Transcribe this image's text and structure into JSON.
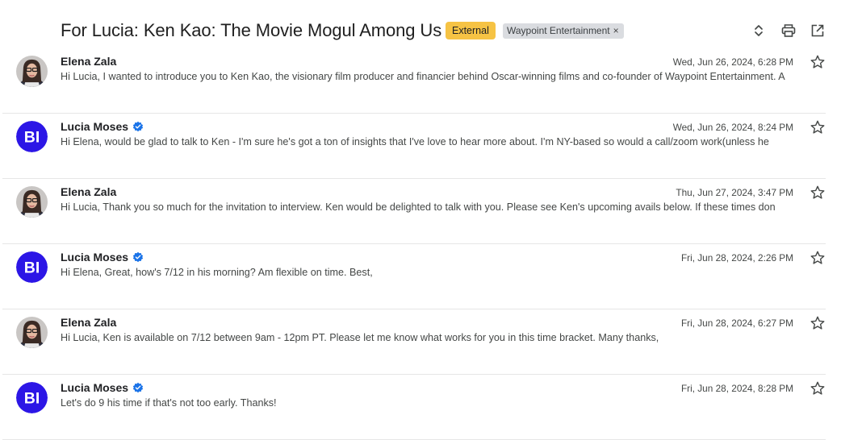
{
  "header": {
    "subject": "For Lucia: Ken Kao: The Movie Mogul Among Us",
    "labels": {
      "external": "External",
      "waypoint": "Waypoint Entertainment",
      "remove": "×"
    }
  },
  "messages": [
    {
      "sender": "Elena Zala",
      "verified": false,
      "avatar": "photo",
      "date": "Wed, Jun 26, 2024, 6:28 PM",
      "snippet": "Hi Lucia, I wanted to introduce you to Ken Kao, the visionary film producer and financier behind Oscar-winning films and co-founder of Waypoint Entertainment. A"
    },
    {
      "sender": "Lucia Moses",
      "verified": true,
      "avatar": "BI",
      "date": "Wed, Jun 26, 2024, 8:24 PM",
      "snippet": "Hi Elena, would be glad to talk to Ken - I'm sure he's got a ton of insights that I've love to hear more about. I'm NY-based so would a call/zoom work(unless he"
    },
    {
      "sender": "Elena Zala",
      "verified": false,
      "avatar": "photo",
      "date": "Thu, Jun 27, 2024, 3:47 PM",
      "snippet": "Hi Lucia, Thank you so much for the invitation to interview. Ken would be delighted to talk with you. Please see Ken's upcoming avails below. If these times don"
    },
    {
      "sender": "Lucia Moses",
      "verified": true,
      "avatar": "BI",
      "date": "Fri, Jun 28, 2024, 2:26 PM",
      "snippet": "Hi Elena, Great, how's 7/12 in his morning? Am flexible on time. Best,"
    },
    {
      "sender": "Elena Zala",
      "verified": false,
      "avatar": "photo",
      "date": "Fri, Jun 28, 2024, 6:27 PM",
      "snippet": "Hi Lucia, Ken is available on 7/12 between 9am - 12pm PT. Please let me know what works for you in this time bracket. Many thanks,"
    },
    {
      "sender": "Lucia Moses",
      "verified": true,
      "avatar": "BI",
      "date": "Fri, Jun 28, 2024, 8:28 PM",
      "snippet": "Let's do 9 his time if that's not too early. Thanks!"
    }
  ],
  "colors": {
    "external_label": "#f6c344",
    "bi_avatar": "#2c16e6",
    "verified": "#1a73e8"
  },
  "icons": {
    "expand": "unfold-icon",
    "print": "print-icon",
    "popout": "open-in-new-icon",
    "star": "star-outline-icon"
  }
}
